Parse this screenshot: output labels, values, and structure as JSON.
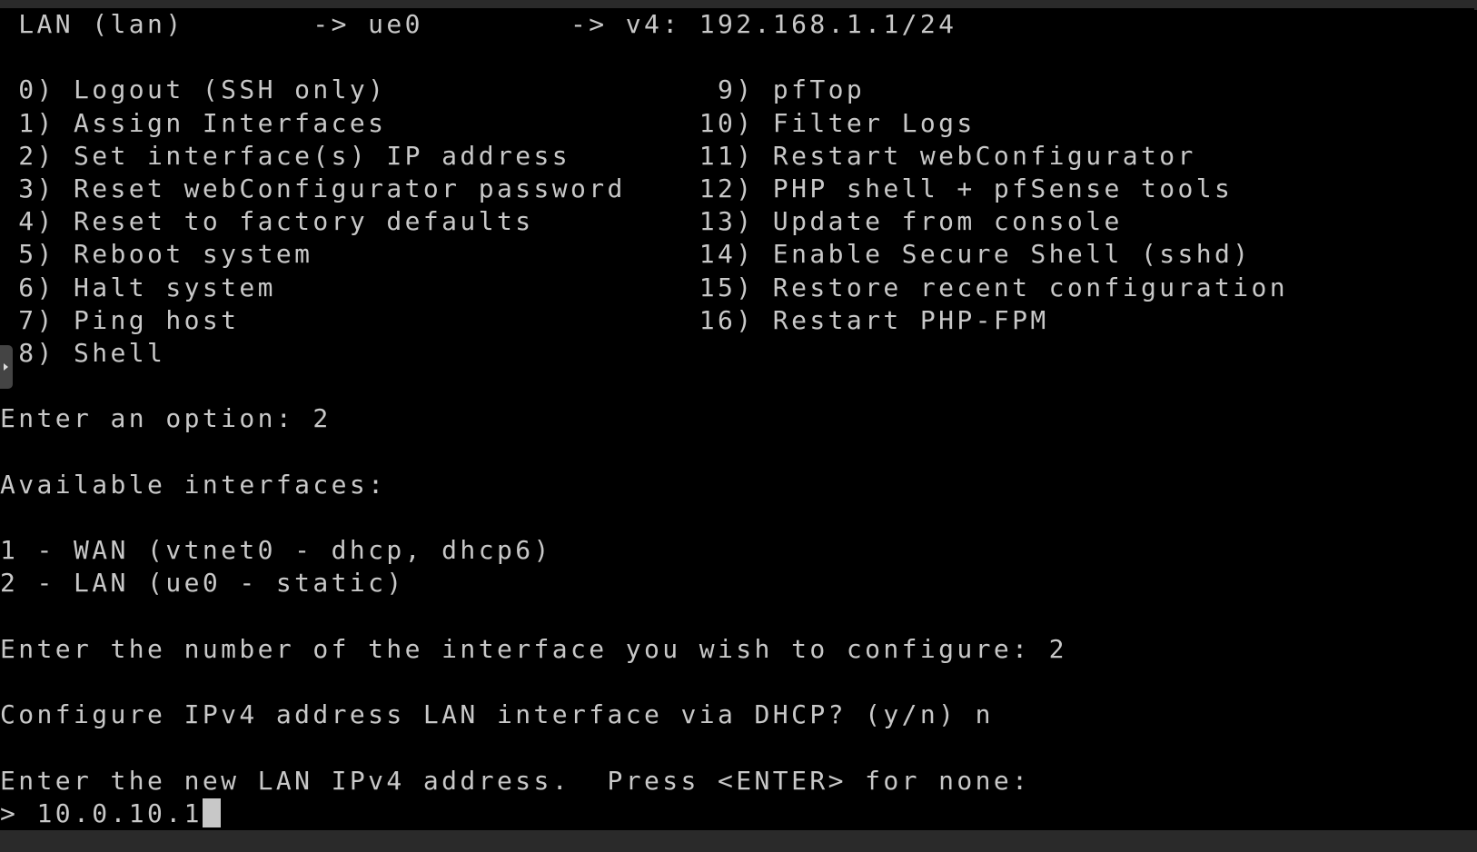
{
  "terminal": {
    "lines": [
      " LAN (lan)       -> ue0        -> v4: 192.168.1.1/24",
      "",
      " 0) Logout (SSH only)                  9) pfTop",
      " 1) Assign Interfaces                 10) Filter Logs",
      " 2) Set interface(s) IP address       11) Restart webConfigurator",
      " 3) Reset webConfigurator password    12) PHP shell + pfSense tools",
      " 4) Reset to factory defaults         13) Update from console",
      " 5) Reboot system                     14) Enable Secure Shell (sshd)",
      " 6) Halt system                       15) Restore recent configuration",
      " 7) Ping host                         16) Restart PHP-FPM",
      " 8) Shell",
      "",
      "Enter an option: 2",
      "",
      "Available interfaces:",
      "",
      "1 - WAN (vtnet0 - dhcp, dhcp6)",
      "2 - LAN (ue0 - static)",
      "",
      "Enter the number of the interface you wish to configure: 2",
      "",
      "Configure IPv4 address LAN interface via DHCP? (y/n) n",
      "",
      "Enter the new LAN IPv4 address.  Press <ENTER> for none:"
    ],
    "prompt": "> ",
    "input_value": "10.0.10.1"
  },
  "colors": {
    "text": "#c8c8c8",
    "background": "#000000",
    "chrome": "#2a2a2a"
  },
  "icons": {
    "side_handle": "triangle-right-icon"
  }
}
